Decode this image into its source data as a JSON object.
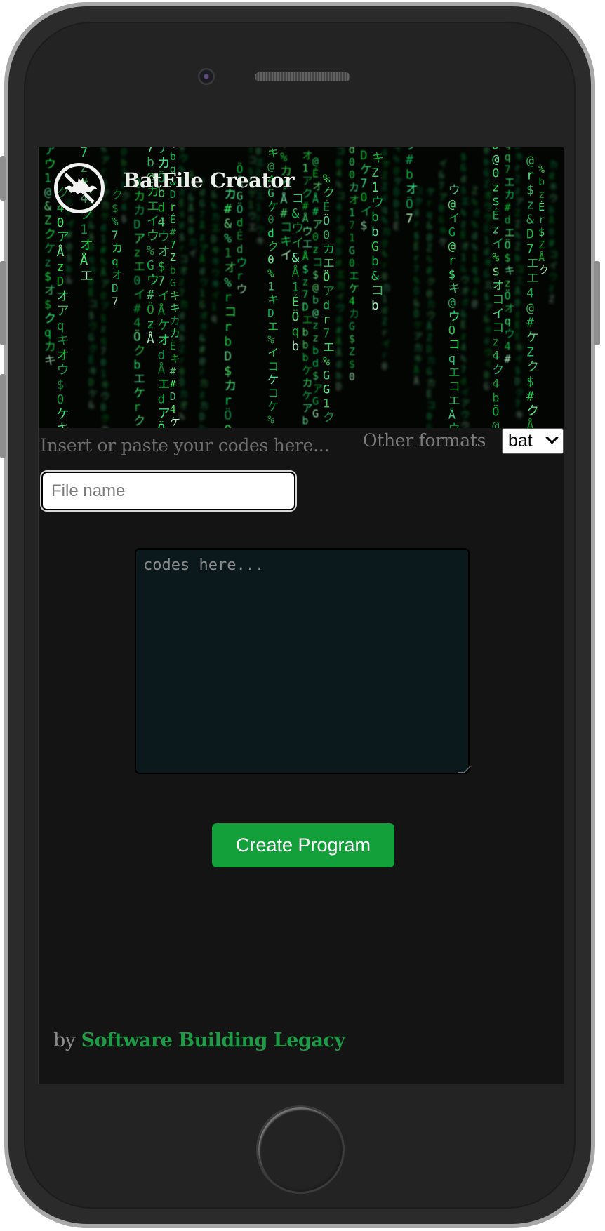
{
  "app": {
    "title": "BatFile Creator"
  },
  "editor": {
    "instruction": "Insert or paste your codes here...",
    "formats_label": "Other formats",
    "format_selected": "bat",
    "filename_placeholder": "File name",
    "code_placeholder": "codes here...",
    "create_button_label": "Create Program"
  },
  "footer": {
    "prefix": "by",
    "author": "Software Building Legacy"
  },
  "colors": {
    "accent": "#13a03b",
    "author_link": "#1f9a47",
    "screen_background": "#141414",
    "code_background": "#0b191d",
    "matrix_green": "#22d45a"
  },
  "icons": {
    "logo": "bat-slash-icon",
    "select_arrow": "chevron-down-icon"
  }
}
